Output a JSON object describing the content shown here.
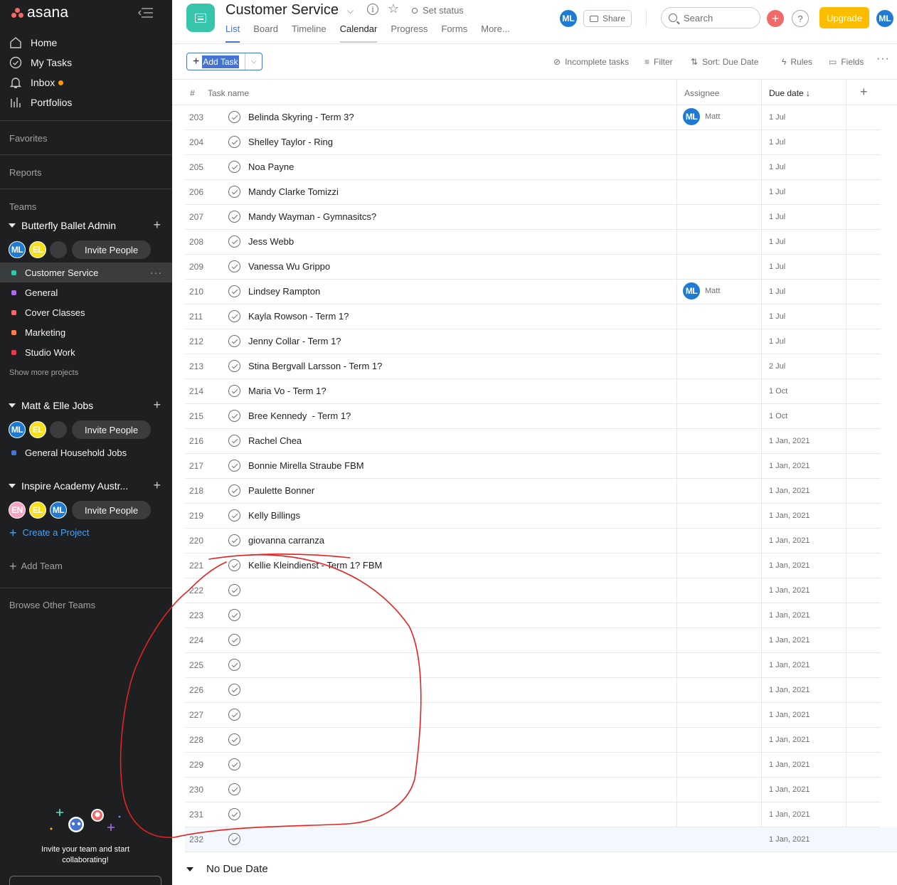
{
  "sidebar": {
    "logo": "asana",
    "nav": [
      {
        "label": "Home",
        "icon": "home-icon"
      },
      {
        "label": "My Tasks",
        "icon": "check-circle-icon"
      },
      {
        "label": "Inbox",
        "icon": "bell-icon"
      },
      {
        "label": "Portfolios",
        "icon": "bar-chart-icon"
      }
    ],
    "favorites": "Favorites",
    "reports": "Reports",
    "teams_label": "Teams",
    "teams": [
      {
        "name": "Butterfly Ballet Admin",
        "avatars": [
          "ML",
          "EL",
          ""
        ],
        "invite": "Invite People",
        "projects": [
          {
            "name": "Customer Service",
            "color": "#37c5ab"
          },
          {
            "name": "General",
            "color": "#a86ee7"
          },
          {
            "name": "Cover Classes",
            "color": "#f06a6a"
          },
          {
            "name": "Marketing",
            "color": "#fc7d4a"
          },
          {
            "name": "Studio Work",
            "color": "#e8384f"
          }
        ],
        "show_more": "Show more projects"
      },
      {
        "name": "Matt & Elle Jobs",
        "avatars": [
          "ML",
          "EL",
          ""
        ],
        "invite": "Invite People",
        "projects": [
          {
            "name": "General Household Jobs",
            "color": "#4573d2"
          }
        ]
      },
      {
        "name": "Inspire Academy Austr...",
        "avatars": [
          "EN",
          "EL",
          "ML"
        ],
        "invite": "Invite People",
        "create_project": "Create a Project"
      }
    ],
    "add_team": "Add Team",
    "browse_teams": "Browse Other Teams",
    "invite_text": "Invite your team and start collaborating!"
  },
  "header": {
    "title": "Customer Service",
    "set_status": "Set status",
    "tabs": [
      "List",
      "Board",
      "Timeline",
      "Calendar",
      "Progress",
      "Forms",
      "More..."
    ],
    "avatar": "ML",
    "share": "Share",
    "search_placeholder": "Search",
    "help": "?",
    "upgrade": "Upgrade",
    "user_avatar": "ML"
  },
  "toolbar": {
    "add_task": "Add Task",
    "incomplete": "Incomplete tasks",
    "filter": "Filter",
    "sort": "Sort: Due Date",
    "rules": "Rules",
    "fields": "Fields"
  },
  "table": {
    "col_num": "#",
    "col_name": "Task name",
    "col_assignee": "Assignee",
    "col_due": "Due date",
    "rows": [
      {
        "num": "203",
        "name": "Belinda Skyring - Term 3?",
        "assignee": "Matt",
        "due": "1 Jul"
      },
      {
        "num": "204",
        "name": "Shelley Taylor - Ring",
        "assignee": "",
        "due": "1 Jul"
      },
      {
        "num": "205",
        "name": "Noa Payne",
        "assignee": "",
        "due": "1 Jul"
      },
      {
        "num": "206",
        "name": "Mandy Clarke Tomizzi",
        "assignee": "",
        "due": "1 Jul"
      },
      {
        "num": "207",
        "name": "Mandy Wayman - Gymnasitcs?",
        "assignee": "",
        "due": "1 Jul"
      },
      {
        "num": "208",
        "name": "Jess Webb",
        "assignee": "",
        "due": "1 Jul"
      },
      {
        "num": "209",
        "name": "Vanessa Wu Grippo",
        "assignee": "",
        "due": "1 Jul"
      },
      {
        "num": "210",
        "name": "Lindsey Rampton",
        "assignee": "Matt",
        "due": "1 Jul"
      },
      {
        "num": "211",
        "name": "Kayla Rowson - Term 1?",
        "assignee": "",
        "due": "1 Jul"
      },
      {
        "num": "212",
        "name": "Jenny Collar - Term 1?",
        "assignee": "",
        "due": "1 Jul"
      },
      {
        "num": "213",
        "name": "Stina Bergvall Larsson - Term 1?",
        "assignee": "",
        "due": "2 Jul"
      },
      {
        "num": "214",
        "name": "Maria Vo - Term 1?",
        "assignee": "",
        "due": "1 Oct"
      },
      {
        "num": "215",
        "name": "Bree Kennedy  - Term 1?",
        "assignee": "",
        "due": "1 Oct"
      },
      {
        "num": "216",
        "name": "Rachel Chea",
        "assignee": "",
        "due": "1 Jan, 2021"
      },
      {
        "num": "217",
        "name": "Bonnie Mirella Straube FBM",
        "assignee": "",
        "due": "1 Jan, 2021"
      },
      {
        "num": "218",
        "name": "Paulette Bonner",
        "assignee": "",
        "due": "1 Jan, 2021"
      },
      {
        "num": "219",
        "name": "Kelly Billings",
        "assignee": "",
        "due": "1 Jan, 2021"
      },
      {
        "num": "220",
        "name": "giovanna carranza",
        "assignee": "",
        "due": "1 Jan, 2021"
      },
      {
        "num": "221",
        "name": "Kellie Kleindienst - Term 1? FBM",
        "assignee": "",
        "due": "1 Jan, 2021"
      },
      {
        "num": "222",
        "name": "",
        "assignee": "",
        "due": "1 Jan, 2021"
      },
      {
        "num": "223",
        "name": "",
        "assignee": "",
        "due": "1 Jan, 2021"
      },
      {
        "num": "224",
        "name": "",
        "assignee": "",
        "due": "1 Jan, 2021"
      },
      {
        "num": "225",
        "name": "",
        "assignee": "",
        "due": "1 Jan, 2021"
      },
      {
        "num": "226",
        "name": "",
        "assignee": "",
        "due": "1 Jan, 2021"
      },
      {
        "num": "227",
        "name": "",
        "assignee": "",
        "due": "1 Jan, 2021"
      },
      {
        "num": "228",
        "name": "",
        "assignee": "",
        "due": "1 Jan, 2021"
      },
      {
        "num": "229",
        "name": "",
        "assignee": "",
        "due": "1 Jan, 2021"
      },
      {
        "num": "230",
        "name": "",
        "assignee": "",
        "due": "1 Jan, 2021"
      },
      {
        "num": "231",
        "name": "",
        "assignee": "",
        "due": "1 Jan, 2021"
      },
      {
        "num": "232",
        "name": "",
        "assignee": "",
        "due": "1 Jan, 2021"
      }
    ],
    "no_due_section": "No Due Date"
  }
}
